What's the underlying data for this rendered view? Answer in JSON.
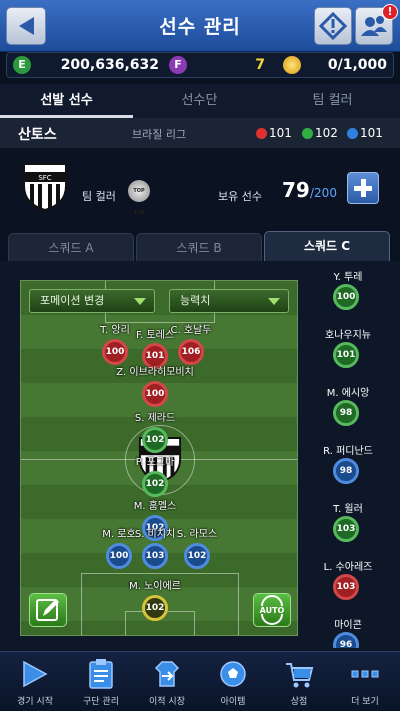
{
  "header": {
    "title": "선수 관리",
    "notification_count": "!"
  },
  "currency": [
    {
      "icon": "e-coin-icon",
      "letter": "E",
      "color": "#2a9a3d",
      "value": "200,636,632"
    },
    {
      "icon": "f-coin-icon",
      "letter": "F",
      "color": "#8a3bb3",
      "value": "7"
    },
    {
      "icon": "gold-coin-icon",
      "letter": "",
      "color": "#e8b31c",
      "value": "0/1,000"
    }
  ],
  "main_tabs": [
    {
      "label": "선발 선수",
      "active": true
    },
    {
      "label": "선수단",
      "active": false
    },
    {
      "label": "팀 컬러",
      "active": false
    }
  ],
  "club": {
    "name": "산토스",
    "league": "브라질 리그",
    "stats": [
      {
        "color": "#e03030",
        "value": "101"
      },
      {
        "color": "#30b040",
        "value": "102"
      },
      {
        "color": "#3080e0",
        "value": "101"
      }
    ],
    "team_color_label": "팀 컬러",
    "team_color_badge": "TOP 100",
    "owned_label": "보유 선수",
    "owned_count": "79",
    "owned_max": "/200"
  },
  "squad_tabs": [
    {
      "label": "스쿼드 A",
      "active": false
    },
    {
      "label": "스쿼드 B",
      "active": false
    },
    {
      "label": "스쿼드 C",
      "active": true
    }
  ],
  "pitch": {
    "formation_button": "포메이션 변경",
    "sort_button": "능력치",
    "players": [
      {
        "name": "T. 앙리",
        "ovr": "100",
        "tier": "red"
      },
      {
        "name": "F. 토레스",
        "ovr": "101",
        "tier": "red"
      },
      {
        "name": "C. 호날두",
        "ovr": "106",
        "tier": "red"
      },
      {
        "name": "Z. 이브라히모비치",
        "ovr": "100",
        "tier": "red"
      },
      {
        "name": "S. 제라드",
        "ovr": "102",
        "tier": "green"
      },
      {
        "name": "P. 포그바",
        "ovr": "102",
        "tier": "green"
      },
      {
        "name": "M. 훔멜스",
        "ovr": "102",
        "tier": "blue"
      },
      {
        "name": "M. 로호",
        "ovr": "100",
        "tier": "blue"
      },
      {
        "name": "S. 비치치",
        "ovr": "103",
        "tier": "blue"
      },
      {
        "name": "S. 라모스",
        "ovr": "102",
        "tier": "blue"
      },
      {
        "name": "M. 노이에르",
        "ovr": "102",
        "tier": "gk"
      }
    ]
  },
  "bench": [
    {
      "name": "Y. 투레",
      "ovr": "100",
      "tier": "green"
    },
    {
      "name": "호나우지뉴",
      "ovr": "101",
      "tier": "green"
    },
    {
      "name": "M. 에시앙",
      "ovr": "98",
      "tier": "green"
    },
    {
      "name": "R. 퍼디난드",
      "ovr": "98",
      "tier": "blue"
    },
    {
      "name": "T. 윌러",
      "ovr": "103",
      "tier": "green"
    },
    {
      "name": "L. 수아레즈",
      "ovr": "103",
      "tier": "red"
    },
    {
      "name": "마이콘",
      "ovr": "96",
      "tier": "blue"
    }
  ],
  "bottom_nav": [
    {
      "label": "경기 시작",
      "icon": "play-icon"
    },
    {
      "label": "구단 관리",
      "icon": "clipboard-icon"
    },
    {
      "label": "이적 시장",
      "icon": "transfer-icon"
    },
    {
      "label": "아이템",
      "icon": "ball-icon"
    },
    {
      "label": "상점",
      "icon": "cart-icon"
    },
    {
      "label": "더 보기",
      "icon": "more-icon"
    }
  ]
}
